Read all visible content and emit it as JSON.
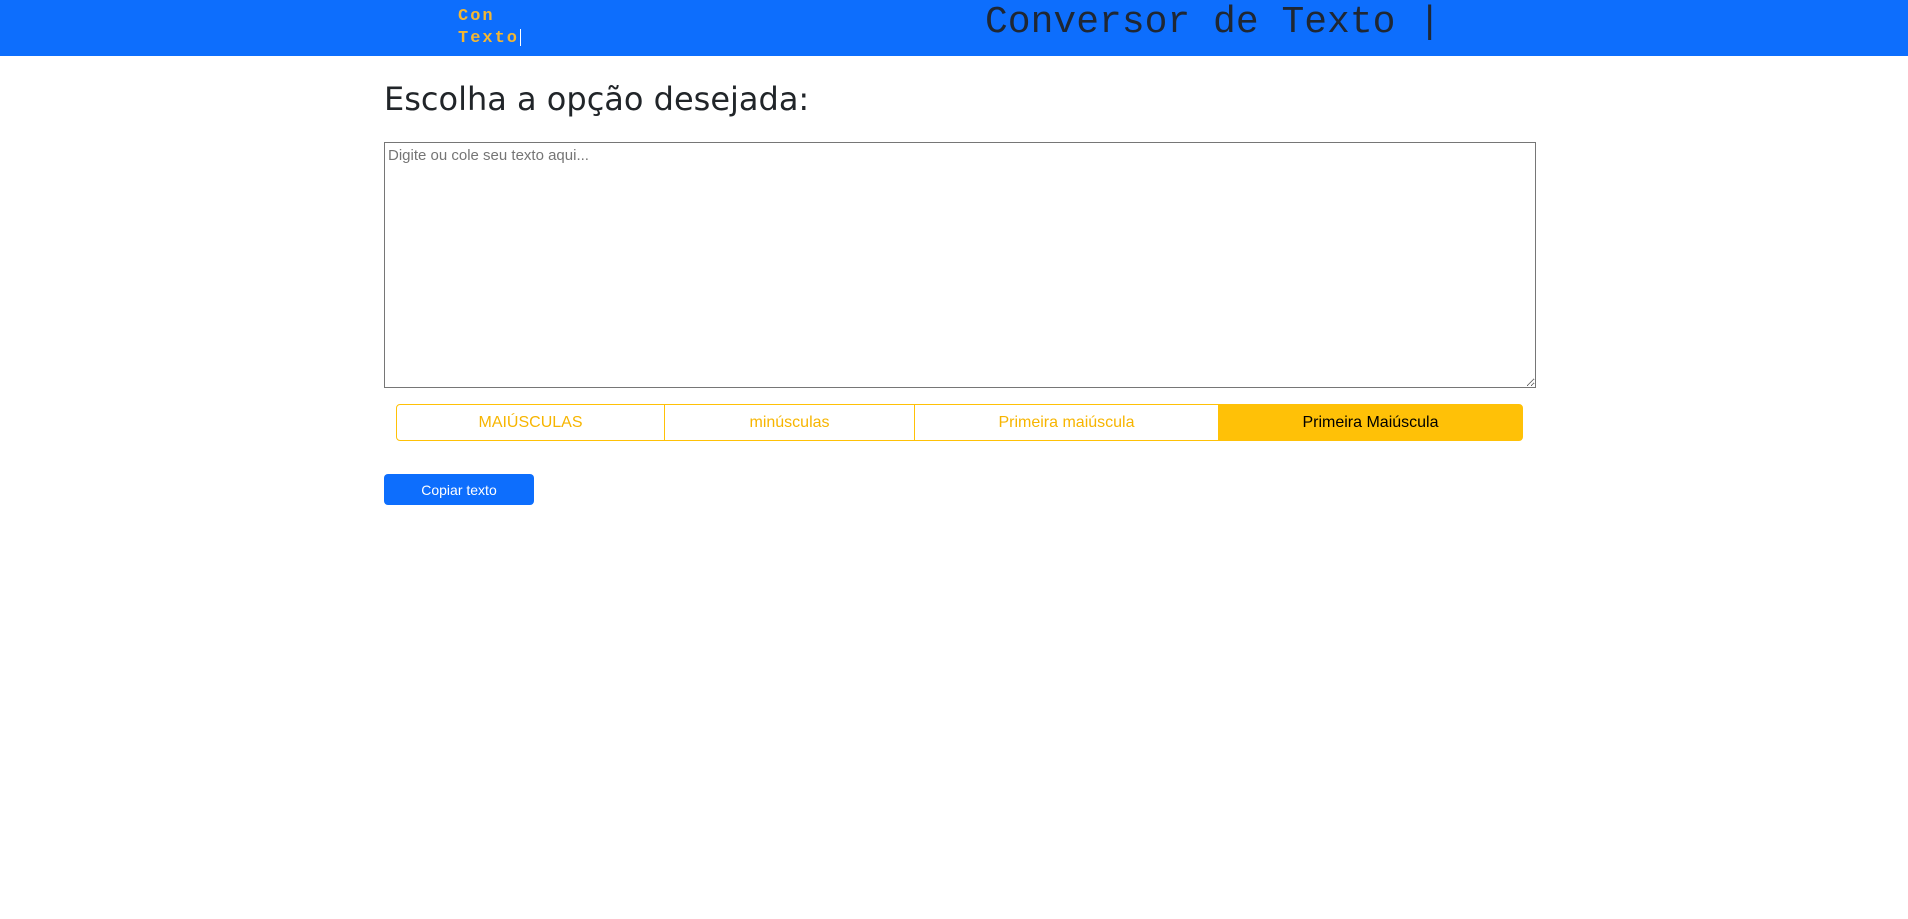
{
  "navbar": {
    "brand_line1": "Con",
    "brand_line2": "Texto",
    "title": "Conversor de Texto |",
    "background_color": "#0d6efd",
    "brand_color": "#f5b731"
  },
  "main": {
    "heading": "Escolha a opção desejada:",
    "textarea": {
      "value": "",
      "placeholder": "Digite ou cole seu texto aqui..."
    },
    "options": [
      {
        "label": "MAIÚSCULAS",
        "active": false
      },
      {
        "label": "minúsculas",
        "active": false
      },
      {
        "label": "Primeira maiúscula",
        "active": false
      },
      {
        "label": "Primeira Maiúscula",
        "active": true
      }
    ],
    "option_color": "#ffc107",
    "copy_button": "Copiar texto",
    "copy_button_color": "#0d6efd"
  }
}
